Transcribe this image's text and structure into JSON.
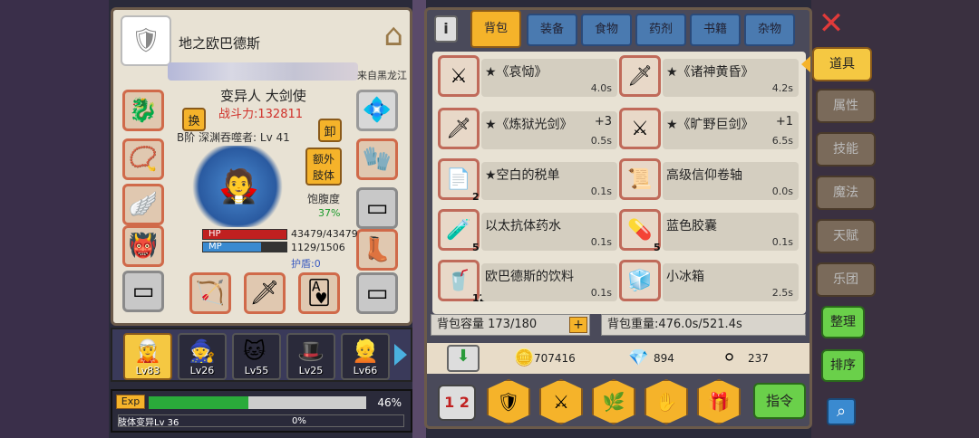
{
  "character": {
    "name": "地之欧巴德斯",
    "from": "来自黑龙江",
    "class": "变异人 大剑使",
    "power": "战斗力:132811",
    "rank": "B阶 深渊吞噬者: Lv 41",
    "swap_label": "换",
    "unequip_label": "卸",
    "extra_label_1": "额外",
    "extra_label_2": "肢体",
    "satiety_label": "饱腹度",
    "satiety_value": "37%",
    "hp_label": "HP",
    "hp_value": "43479/43479",
    "mp_label": "MP",
    "mp_value": "1129/1506",
    "shield": "护盾:0"
  },
  "party": [
    {
      "lv": "Lv83",
      "icon": "🧝"
    },
    {
      "lv": "Lv26",
      "icon": "🧙"
    },
    {
      "lv": "Lv55",
      "icon": "🐱"
    },
    {
      "lv": "Lv25",
      "icon": "🎩"
    },
    {
      "lv": "Lv66",
      "icon": "👱"
    }
  ],
  "exp": {
    "badge": "Exp",
    "percent": "46%",
    "variant_label": "肢体变异Lv 36",
    "variant_percent": "0%"
  },
  "tabs": [
    "背包",
    "装备",
    "食物",
    "药剂",
    "书籍",
    "杂物"
  ],
  "items": [
    {
      "name": "★《哀恸》",
      "plus": "",
      "weight": "4.0s",
      "count": "",
      "icon": "⚔"
    },
    {
      "name": "★《诸神黄昏》",
      "plus": "",
      "weight": "4.2s",
      "count": "",
      "icon": "🗡"
    },
    {
      "name": "★《炼狱光剑》",
      "plus": "+3",
      "weight": "0.5s",
      "count": "",
      "icon": "🗡"
    },
    {
      "name": "★《旷野巨剑》",
      "plus": "+1",
      "weight": "6.5s",
      "count": "",
      "icon": "⚔"
    },
    {
      "name": "★空白的税单",
      "plus": "",
      "weight": "0.1s",
      "count": "2",
      "icon": "📄"
    },
    {
      "name": "高级信仰卷轴",
      "plus": "",
      "weight": "0.0s",
      "count": "",
      "icon": "📜"
    },
    {
      "name": "以太抗体药水",
      "plus": "",
      "weight": "0.1s",
      "count": "5",
      "icon": "🧪"
    },
    {
      "name": "蓝色胶囊",
      "plus": "",
      "weight": "0.1s",
      "count": "5",
      "icon": "💊"
    },
    {
      "name": "欧巴德斯的饮料",
      "plus": "",
      "weight": "0.1s",
      "count": "12",
      "icon": "🥤"
    },
    {
      "name": "小冰箱",
      "plus": "",
      "weight": "2.5s",
      "count": "",
      "icon": "🧊"
    }
  ],
  "bag": {
    "capacity": "背包容量 173/180",
    "weight": "背包重量:476.0s/521.4s"
  },
  "currency": {
    "gold": "707416",
    "diamond": "894",
    "silver": "237"
  },
  "command_label": "指令",
  "side_tabs": [
    "道具",
    "属性",
    "技能",
    "魔法",
    "天赋",
    "乐团"
  ],
  "side_buttons": [
    "整理",
    "排序"
  ]
}
